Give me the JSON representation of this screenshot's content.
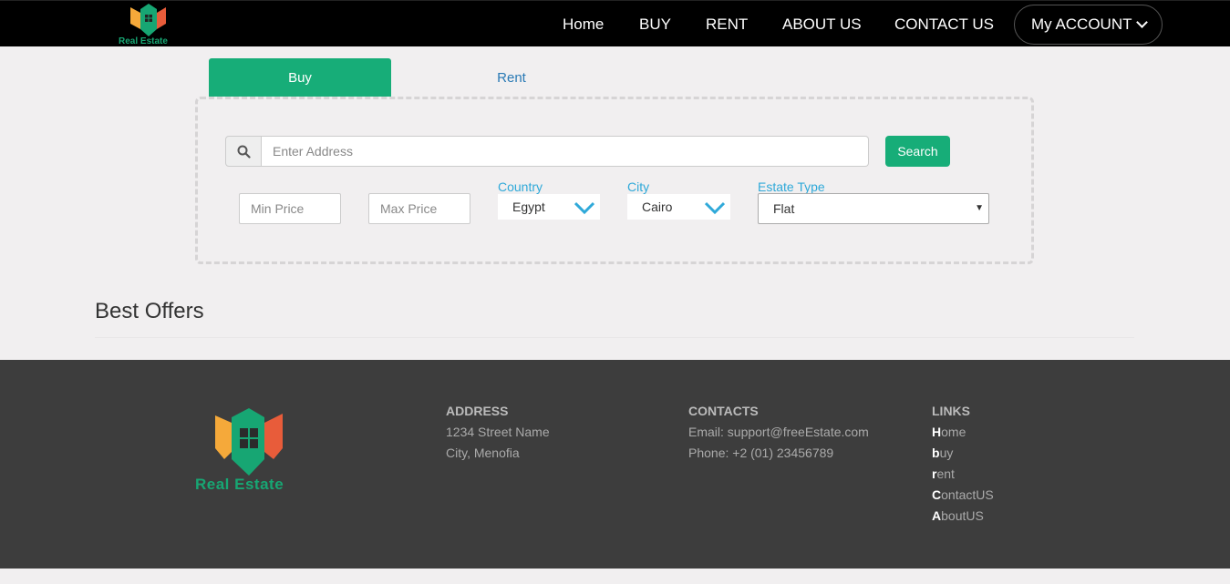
{
  "colors": {
    "accent": "#17ad78",
    "label": "#2fa9d9",
    "footer_bg": "#3d3d3d",
    "navbar_bg": "#000000"
  },
  "brand": {
    "name": "Real Estate"
  },
  "nav": {
    "links": [
      "Home",
      "BUY",
      "RENT",
      "ABOUT US",
      "CONTACT US"
    ],
    "account_label": "My ACCOUNT"
  },
  "tabs": {
    "buy": "Buy",
    "rent": "Rent"
  },
  "search": {
    "icon": "search-icon",
    "placeholder": "Enter Address",
    "button_label": "Search"
  },
  "filters": {
    "min_price_placeholder": "Min Price",
    "max_price_placeholder": "Max Price",
    "country": {
      "label": "Country",
      "value": "Egypt"
    },
    "city": {
      "label": "City",
      "value": "Cairo"
    },
    "estate_type": {
      "label": "Estate Type",
      "value": "Flat"
    }
  },
  "offers": {
    "heading": "Best Offers"
  },
  "footer": {
    "address": {
      "heading": "ADDRESS",
      "line1": "1234 Street Name",
      "line2": "City, Menofia"
    },
    "contacts": {
      "heading": "CONTACTS",
      "email": "Email: support@freeEstate.com",
      "phone": "Phone: +2 (01) 23456789"
    },
    "links": {
      "heading": "LINKS",
      "items": [
        {
          "first": "H",
          "rest": "ome"
        },
        {
          "first": "b",
          "rest": "uy"
        },
        {
          "first": "r",
          "rest": "ent"
        },
        {
          "first": "C",
          "rest": "ontactUS"
        },
        {
          "first": "A",
          "rest": "boutUS"
        }
      ]
    }
  }
}
